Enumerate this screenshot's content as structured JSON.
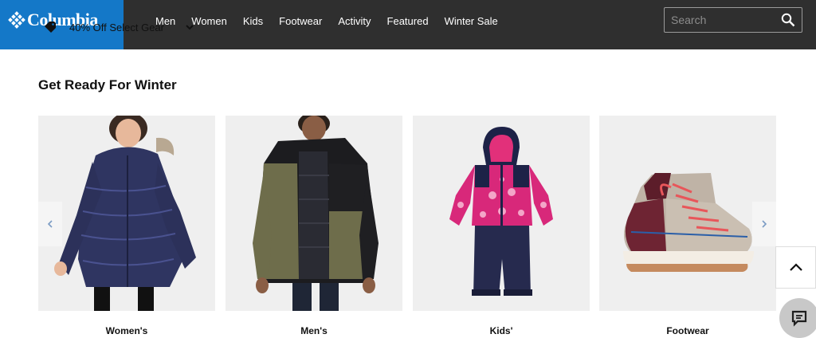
{
  "header": {
    "brand": "Columbia",
    "promo_text": "40% Off Select Gear",
    "nav": [
      "Men",
      "Women",
      "Kids",
      "Footwear",
      "Activity",
      "Featured",
      "Winter Sale"
    ],
    "search": {
      "placeholder": "Search",
      "value": ""
    }
  },
  "main": {
    "heading": "Get Ready For Winter",
    "cards": [
      {
        "label": "Women's"
      },
      {
        "label": "Men's"
      },
      {
        "label": "Kids'"
      },
      {
        "label": "Footwear"
      }
    ]
  },
  "colors": {
    "brand_blue": "#1478c8",
    "header_bg": "#2f2f2f",
    "card_bg": "#efefef"
  },
  "icons": {
    "logo": "diamond-logo-icon",
    "promo": "tag-icon",
    "promo_toggle": "chevron-down-icon",
    "search": "search-icon",
    "carousel_prev": "chevron-left-icon",
    "carousel_next": "chevron-right-icon",
    "back_to_top": "chevron-up-icon",
    "chat": "chat-bubble-icon"
  }
}
